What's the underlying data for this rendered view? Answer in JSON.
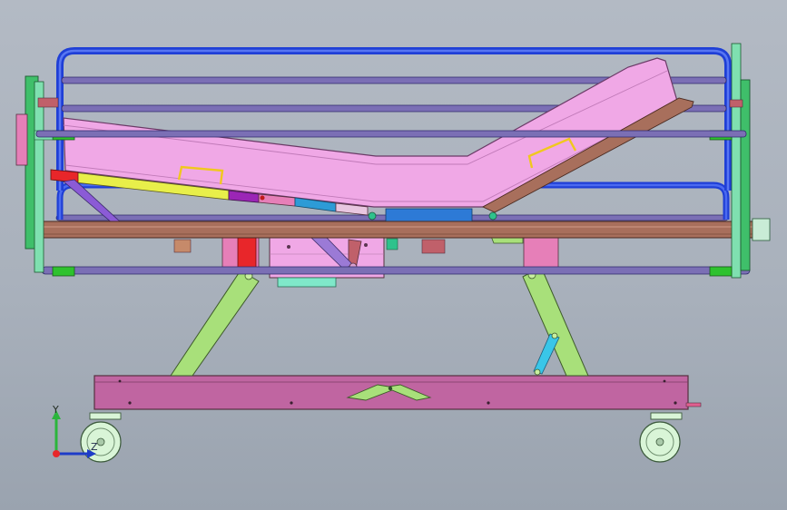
{
  "triad": {
    "y_label": "Y",
    "z_label": "Z",
    "x_color": "#e8262a",
    "y_color": "#2bb53c",
    "z_color": "#1e3cc8"
  },
  "colors": {
    "background": "#adb4be",
    "rails": "#1f3fd6",
    "rail_bars": "#7b6fb5",
    "mattress": "#f0a8e6",
    "base_frame": "#c065a1",
    "scissor_legs": "#a8e07a",
    "caster_wheel": "#d9f5d7",
    "end_panels": "#3fbf6a",
    "platform_rail": "#a86f5c",
    "handles": "#f0c81e",
    "actuator": "#e53a3a",
    "motor_box": "#f0a8e6",
    "board_slats": "#2d7ad6"
  }
}
